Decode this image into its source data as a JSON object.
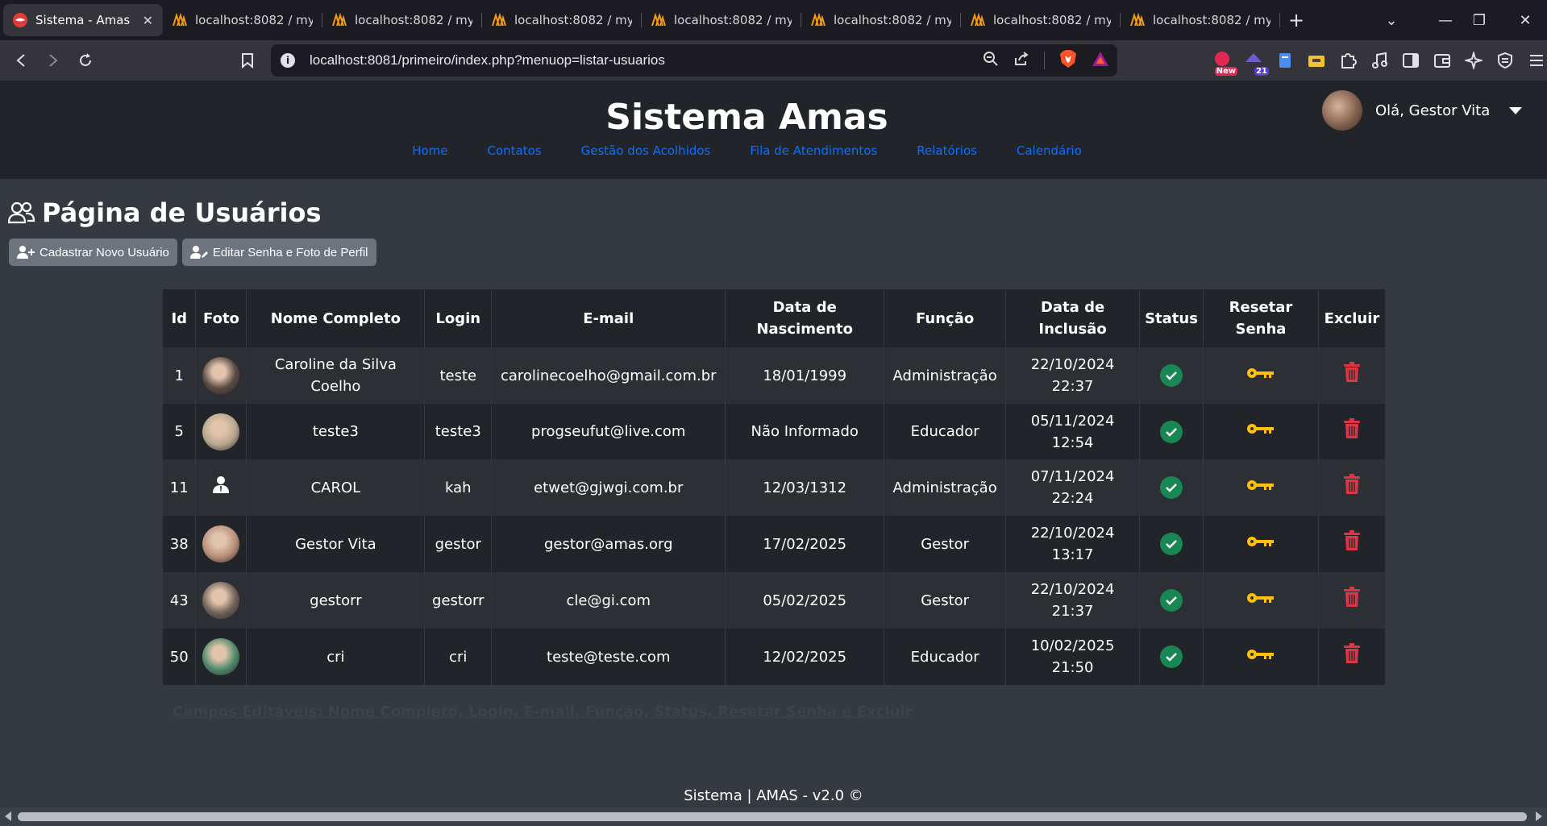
{
  "browser": {
    "tabs": [
      {
        "title": "Sistema - Amas",
        "active": true,
        "close": "✕"
      },
      {
        "title": "localhost:8082 / mysq",
        "active": false
      },
      {
        "title": "localhost:8082 / mysq",
        "active": false
      },
      {
        "title": "localhost:8082 / mysq",
        "active": false
      },
      {
        "title": "localhost:8082 / mysq",
        "active": false
      },
      {
        "title": "localhost:8082 / mysq",
        "active": false
      },
      {
        "title": "localhost:8082 / mysq",
        "active": false
      },
      {
        "title": "localhost:8082 / mysq",
        "active": false
      }
    ],
    "url": "localhost:8081/primeiro/index.php?menuop=listar-usuarios",
    "ext_badges": {
      "new": "New",
      "count": "21"
    }
  },
  "site": {
    "brand": "Sistema Amas",
    "menu": [
      "Home",
      "Contatos",
      "Gestão dos Acolhidos",
      "Fila de Atendimentos",
      "Relatórios",
      "Calendário"
    ],
    "greeting": "Olá, Gestor Vita"
  },
  "page": {
    "title": "Página de Usuários",
    "btn_new": "Cadastrar Novo Usuário",
    "btn_edit": "Editar Senha e Foto de Perfil",
    "note": "Campos Editáveis: Nome Completo, Login, E-mail, Função, Status, Resetar Senha e Excluir",
    "footer": "Sistema | AMAS - v2.0 ©"
  },
  "table": {
    "headers": {
      "id": "Id",
      "foto": "Foto",
      "nome": "Nome Completo",
      "login": "Login",
      "email": "E-mail",
      "nasc_1": "Data de",
      "nasc_2": "Nascimento",
      "funcao": "Função",
      "incl_1": "Data de",
      "incl_2": "Inclusão",
      "status": "Status",
      "reset_1": "Resetar",
      "reset_2": "Senha",
      "excluir": "Excluir"
    },
    "rows": [
      {
        "id": "1",
        "nome": "Caroline da Silva Coelho",
        "login": "teste",
        "email": "carolinecoelho@gmail.com.br",
        "nasc": "18/01/1999",
        "funcao": "Administração",
        "incl": "22/10/2024 22:37",
        "photo": "#5a4a44"
      },
      {
        "id": "5",
        "nome": "teste3",
        "login": "teste3",
        "email": "progseufut@live.com",
        "nasc": "Não Informado",
        "funcao": "Educador",
        "incl": "05/11/2024 12:54",
        "photo": "#b7a68f"
      },
      {
        "id": "11",
        "nome": "CAROL",
        "login": "kah",
        "email": "etwet@gjwgi.com.br",
        "nasc": "12/03/1312",
        "funcao": "Administração",
        "incl": "07/11/2024 22:24",
        "photo": "none"
      },
      {
        "id": "38",
        "nome": "Gestor Vita",
        "login": "gestor",
        "email": "gestor@amas.org",
        "nasc": "17/02/2025",
        "funcao": "Gestor",
        "incl": "22/10/2024 13:17",
        "photo": "#b88f7a"
      },
      {
        "id": "43",
        "nome": "gestorr",
        "login": "gestorr",
        "email": "cle@gi.com",
        "nasc": "05/02/2025",
        "funcao": "Gestor",
        "incl": "22/10/2024 21:37",
        "photo": "#6e625a"
      },
      {
        "id": "50",
        "nome": "cri",
        "login": "cri",
        "email": "teste@teste.com",
        "nasc": "12/02/2025",
        "funcao": "Educador",
        "incl": "10/02/2025 21:50",
        "photo": "#4f8a6c"
      }
    ]
  },
  "colors": {
    "status_ok": "#198754",
    "key": "#ffc107",
    "delete": "#dc3545",
    "link": "#0d6efd"
  }
}
